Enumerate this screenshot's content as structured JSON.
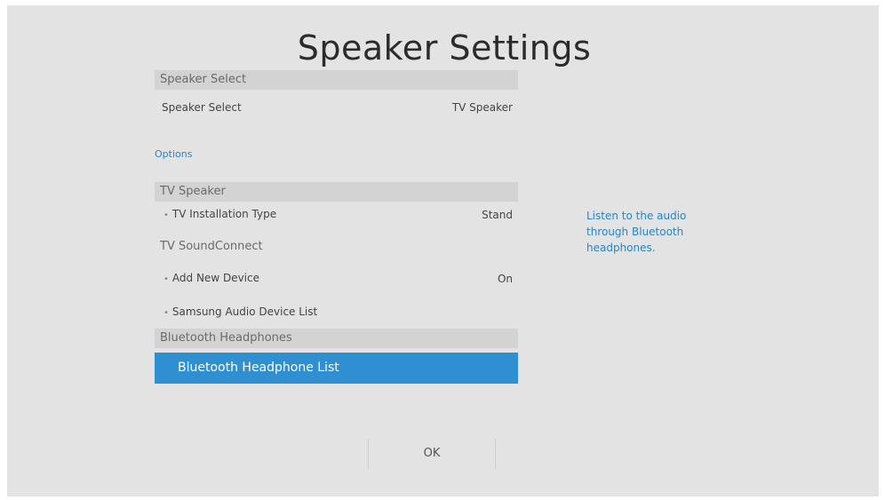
{
  "window": {
    "title": "Speaker Settings"
  },
  "speaker_select_section": {
    "header": "Speaker Select",
    "item_label": "Speaker Select",
    "item_value": "TV Speaker"
  },
  "options_label": "Options",
  "tv_speaker_section": {
    "header": "TV Speaker",
    "installation_type_label": "TV Installation Type",
    "installation_type_value": "Stand"
  },
  "soundconnect_section": {
    "header": "TV SoundConnect",
    "add_new_device_label": "Add New Device",
    "add_new_device_value": "On",
    "audio_device_list_label": "Samsung Audio Device List"
  },
  "bluetooth_section": {
    "header": "Bluetooth Headphones",
    "selected_item": "Bluetooth Headphone List"
  },
  "help": {
    "text": "Listen to the audio through Bluetooth headphones."
  },
  "footer": {
    "ok_label": "OK"
  },
  "colors": {
    "background": "#e3e3e3",
    "section_header": "#d3d3d3",
    "selected_highlight": "#2f8fd0",
    "accent_text": "#2a84c4"
  }
}
